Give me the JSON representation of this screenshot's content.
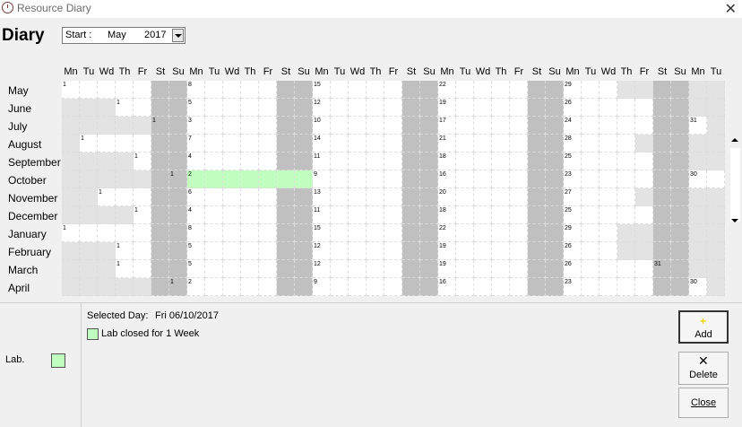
{
  "window": {
    "title": "Resource Diary",
    "close_glyph": "✕"
  },
  "header": {
    "title": "Diary",
    "start_label": "Start :",
    "start_month": "May",
    "start_year": "2017"
  },
  "day_headers": [
    "Mn",
    "Tu",
    "Wd",
    "Th",
    "Fr",
    "St",
    "Su",
    "Mn",
    "Tu",
    "Wd",
    "Th",
    "Fr",
    "St",
    "Su",
    "Mn",
    "Tu",
    "Wd",
    "Th",
    "Fr",
    "St",
    "Su",
    "Mn",
    "Tu",
    "Wd",
    "Th",
    "Fr",
    "St",
    "Su",
    "Mn",
    "Tu",
    "Wd",
    "Th",
    "Fr",
    "St",
    "Su",
    "Mn",
    "Tu"
  ],
  "months": [
    {
      "name": "May",
      "offset": 0,
      "days": 31
    },
    {
      "name": "June",
      "offset": 3,
      "days": 30
    },
    {
      "name": "July",
      "offset": 5,
      "days": 31
    },
    {
      "name": "August",
      "offset": 1,
      "days": 31
    },
    {
      "name": "September",
      "offset": 4,
      "days": 30
    },
    {
      "name": "October",
      "offset": 6,
      "days": 31
    },
    {
      "name": "November",
      "offset": 2,
      "days": 30
    },
    {
      "name": "December",
      "offset": 4,
      "days": 31
    },
    {
      "name": "January",
      "offset": 0,
      "days": 31
    },
    {
      "name": "February",
      "offset": 3,
      "days": 28
    },
    {
      "name": "March",
      "offset": 3,
      "days": 31
    },
    {
      "name": "April",
      "offset": 6,
      "days": 30
    }
  ],
  "colors": {
    "outside": "#e3e3e3",
    "weekend": "#c0c0c0",
    "weekday": "#ffffff",
    "booked": "#c0ffc0"
  },
  "booking": {
    "month_index": 5,
    "from_day": 2,
    "to_day": 8
  },
  "selected": {
    "label": "Selected Day:",
    "value": "Fri 06/10/2017"
  },
  "event": {
    "text": "Lab closed for 1 Week",
    "color": "#c0ffc0"
  },
  "resource": {
    "label": "Lab.",
    "color": "#c0ffc0"
  },
  "buttons": {
    "add": "Add",
    "delete": "Delete",
    "close": "Close"
  },
  "icons": {
    "plus": "+",
    "x": "✕"
  }
}
